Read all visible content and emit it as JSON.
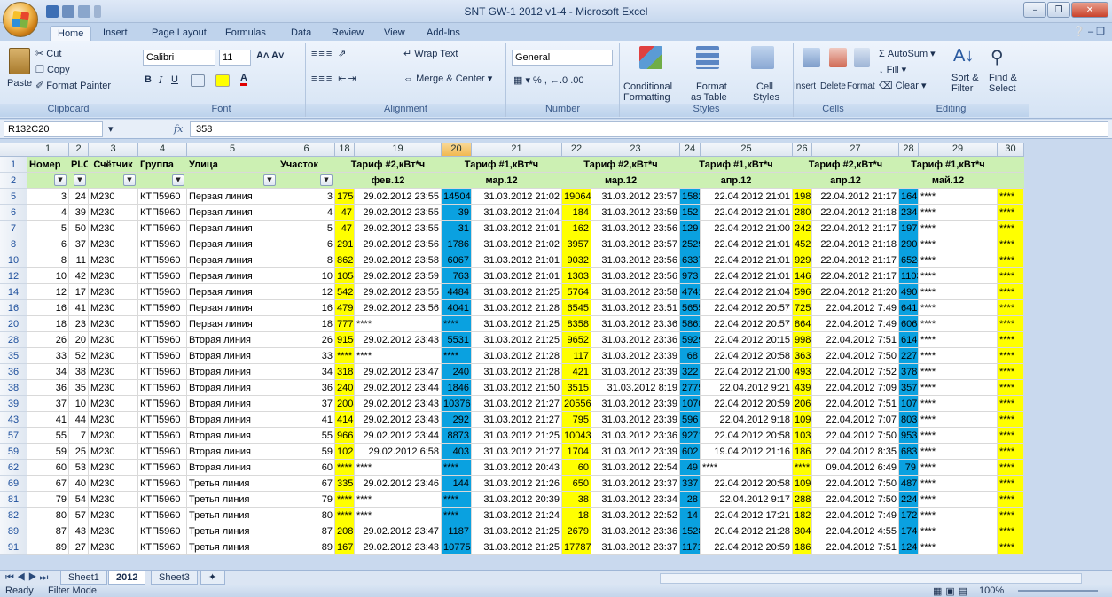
{
  "window": {
    "title": "SNT GW-1 2012 v1-4 - Microsoft Excel"
  },
  "ribbon_tabs": [
    "Home",
    "Insert",
    "Page Layout",
    "Formulas",
    "Data",
    "Review",
    "View",
    "Add-Ins"
  ],
  "ribbon": {
    "clipboard": {
      "label": "Clipboard",
      "paste": "Paste",
      "cut": "Cut",
      "copy": "Copy",
      "format_painter": "Format Painter"
    },
    "font": {
      "label": "Font",
      "name": "Calibri",
      "size": "11"
    },
    "alignment": {
      "label": "Alignment",
      "wrap_text": "Wrap Text",
      "merge_center": "Merge & Center"
    },
    "number": {
      "label": "Number",
      "format": "General"
    },
    "styles": {
      "label": "Styles",
      "conditional": "Conditional",
      "conditional2": "Formatting",
      "format_as": "Format",
      "format_as2": "as Table",
      "cell_styles": "Cell",
      "cell_styles2": "Styles"
    },
    "cells": {
      "label": "Cells",
      "insert": "Insert",
      "delete": "Delete",
      "format": "Format"
    },
    "editing": {
      "label": "Editing",
      "autosum": "AutoSum",
      "fill": "Fill",
      "clear": "Clear",
      "sort": "Sort &",
      "sort2": "Filter",
      "find": "Find &",
      "find2": "Select"
    }
  },
  "formula_bar": {
    "name_box": "R132C20",
    "fx": "fx",
    "value": "358"
  },
  "column_headers": [
    "1",
    "2",
    "3",
    "4",
    "5",
    "6",
    "18",
    "19",
    "20",
    "21",
    "22",
    "23",
    "24",
    "25",
    "26",
    "27",
    "28",
    "29",
    "30"
  ],
  "header_row1": [
    "Номер",
    "PLC",
    "Счётчик",
    "Группа",
    "Улица",
    "Участок",
    "Тариф #2,кВт*ч",
    "Тариф #1,кВт*ч",
    "Тариф #2,кВт*ч",
    "Тариф #1,кВт*ч",
    "Тариф #2,кВт*ч",
    "Тариф #1,кВт*ч"
  ],
  "header_row2": [
    "фев.12",
    "мар.12",
    "мар.12",
    "апр.12",
    "апр.12",
    "май.12"
  ],
  "row_numbers": [
    "1",
    "2",
    "5",
    "6",
    "7",
    "8",
    "10",
    "12",
    "14",
    "16",
    "20",
    "28",
    "35",
    "36",
    "38",
    "39",
    "43",
    "57",
    "59",
    "62",
    "69",
    "81",
    "82",
    "89",
    "91"
  ],
  "rows": [
    [
      "3",
      "24",
      "M230",
      "КТП5960",
      "Первая линия",
      "3",
      "17503",
      "29.02.2012 23:55",
      "14504",
      "31.03.2012 21:02",
      "19064",
      "31.03.2012 23:57",
      "15821",
      "22.04.2012 21:01",
      "19831",
      "22.04.2012 21:17",
      "16431",
      "****",
      "****"
    ],
    [
      "4",
      "39",
      "M230",
      "КТП5960",
      "Первая линия",
      "4",
      "47",
      "29.02.2012 23:55",
      "39",
      "31.03.2012 21:04",
      "184",
      "31.03.2012 23:59",
      "152",
      "22.04.2012 21:01",
      "280",
      "22.04.2012 21:18",
      "234",
      "****",
      "****"
    ],
    [
      "5",
      "50",
      "M230",
      "КТП5960",
      "Первая линия",
      "5",
      "47",
      "29.02.2012 23:55",
      "31",
      "31.03.2012 21:01",
      "162",
      "31.03.2012 23:56",
      "129",
      "22.04.2012 21:00",
      "242",
      "22.04.2012 21:17",
      "197",
      "****",
      "****"
    ],
    [
      "6",
      "37",
      "M230",
      "КТП5960",
      "Первая линия",
      "6",
      "2913",
      "29.02.2012 23:56",
      "1786",
      "31.03.2012 21:02",
      "3957",
      "31.03.2012 23:57",
      "2529",
      "22.04.2012 21:01",
      "4528",
      "22.04.2012 21:18",
      "2905",
      "****",
      "****"
    ],
    [
      "8",
      "11",
      "M230",
      "КТП5960",
      "Первая линия",
      "8",
      "8628",
      "29.02.2012 23:58",
      "6067",
      "31.03.2012 21:01",
      "9032",
      "31.03.2012 23:56",
      "6337",
      "22.04.2012 21:01",
      "9291",
      "22.04.2012 21:17",
      "6524",
      "****",
      "****"
    ],
    [
      "10",
      "42",
      "M230",
      "КТП5960",
      "Первая линия",
      "10",
      "1054",
      "29.02.2012 23:59",
      "763",
      "31.03.2012 21:01",
      "1303",
      "31.03.2012 23:56",
      "973",
      "22.04.2012 21:01",
      "1462",
      "22.04.2012 21:17",
      "1103",
      "****",
      "****"
    ],
    [
      "12",
      "17",
      "M230",
      "КТП5960",
      "Первая линия",
      "12",
      "5428",
      "29.02.2012 23:55",
      "4484",
      "31.03.2012 21:25",
      "5764",
      "31.03.2012 23:58",
      "4741",
      "22.04.2012 21:04",
      "5965",
      "22.04.2012 21:20",
      "4903",
      "****",
      "****"
    ],
    [
      "16",
      "41",
      "M230",
      "КТП5960",
      "Первая линия",
      "16",
      "4793",
      "29.02.2012 23:56",
      "4041",
      "31.03.2012 21:28",
      "6545",
      "31.03.2012 23:51",
      "5655",
      "22.04.2012 20:57",
      "7259",
      "22.04.2012 7:49",
      "6413",
      "****",
      "****"
    ],
    [
      "18",
      "23",
      "M230",
      "КТП5960",
      "Первая линия",
      "18",
      "7773",
      "****",
      "****",
      "31.03.2012 21:25",
      "8358",
      "31.03.2012 23:36",
      "5861",
      "22.04.2012 20:57",
      "8645",
      "22.04.2012 7:49",
      "6068",
      "****",
      "****"
    ],
    [
      "26",
      "20",
      "M230",
      "КТП5960",
      "Вторая линия",
      "26",
      "9150",
      "29.02.2012 23:43",
      "5531",
      "31.03.2012 21:25",
      "9652",
      "31.03.2012 23:36",
      "5929",
      "22.04.2012 20:15",
      "9983",
      "22.04.2012 7:51",
      "6147",
      "****",
      "****"
    ],
    [
      "33",
      "52",
      "M230",
      "КТП5960",
      "Вторая линия",
      "33",
      "****",
      "****",
      "****",
      "31.03.2012 21:28",
      "117",
      "31.03.2012 23:39",
      "68",
      "22.04.2012 20:58",
      "363",
      "22.04.2012 7:50",
      "227",
      "****",
      "****"
    ],
    [
      "34",
      "38",
      "M230",
      "КТП5960",
      "Вторая линия",
      "34",
      "318",
      "29.02.2012 23:47",
      "240",
      "31.03.2012 21:28",
      "421",
      "31.03.2012 23:39",
      "322",
      "22.04.2012 21:00",
      "493",
      "22.04.2012 7:52",
      "378",
      "****",
      "****"
    ],
    [
      "36",
      "35",
      "M230",
      "КТП5960",
      "Вторая линия",
      "36",
      "2409",
      "29.02.2012 23:44",
      "1846",
      "31.03.2012 21:50",
      "3515",
      "31.03.2012 8:19",
      "2775",
      "22.04.2012 9:21",
      "4391",
      "22.04.2012 7:09",
      "3571",
      "****",
      "****"
    ],
    [
      "37",
      "10",
      "M230",
      "КТП5960",
      "Вторая линия",
      "37",
      "20086",
      "29.02.2012 23:43",
      "10376",
      "31.03.2012 21:27",
      "20556",
      "31.03.2012 23:39",
      "10704",
      "22.04.2012 20:59",
      "20697",
      "22.04.2012 7:51",
      "10793",
      "****",
      "****"
    ],
    [
      "41",
      "44",
      "M230",
      "КТП5960",
      "Вторая линия",
      "41",
      "414",
      "29.02.2012 23:43",
      "292",
      "31.03.2012 21:27",
      "795",
      "31.03.2012 23:39",
      "596",
      "22.04.2012 9:18",
      "1091",
      "22.04.2012 7:07",
      "803",
      "****",
      "****"
    ],
    [
      "55",
      "7",
      "M230",
      "КТП5960",
      "Вторая линия",
      "55",
      "9662",
      "29.02.2012 23:44",
      "8873",
      "31.03.2012 21:25",
      "10043",
      "31.03.2012 23:36",
      "9271",
      "22.04.2012 20:58",
      "10314",
      "22.04.2012 7:50",
      "9536",
      "****",
      "****"
    ],
    [
      "59",
      "25",
      "M230",
      "КТП5960",
      "Вторая линия",
      "59",
      "1022",
      "29.02.2012 6:58",
      "403",
      "31.03.2012 21:27",
      "1704",
      "31.03.2012 23:39",
      "602",
      "19.04.2012 21:16",
      "1867",
      "22.04.2012 8:35",
      "683",
      "****",
      "****"
    ],
    [
      "60",
      "53",
      "M230",
      "КТП5960",
      "Вторая линия",
      "60",
      "****",
      "****",
      "****",
      "31.03.2012 20:43",
      "60",
      "31.03.2012 22:54",
      "49",
      "****",
      "****",
      "09.04.2012 6:49",
      "79",
      "****",
      "****"
    ],
    [
      "67",
      "40",
      "M230",
      "КТП5960",
      "Третья линия",
      "67",
      "335",
      "29.02.2012 23:46",
      "144",
      "31.03.2012 21:26",
      "650",
      "31.03.2012 23:37",
      "337",
      "22.04.2012 20:58",
      "1099",
      "22.04.2012 7:50",
      "487",
      "****",
      "****"
    ],
    [
      "79",
      "54",
      "M230",
      "КТП5960",
      "Третья линия",
      "79",
      "****",
      "****",
      "****",
      "31.03.2012 20:39",
      "38",
      "31.03.2012 23:34",
      "28",
      "22.04.2012 9:17",
      "288",
      "22.04.2012 7:50",
      "224",
      "****",
      "****"
    ],
    [
      "80",
      "57",
      "M230",
      "КТП5960",
      "Третья линия",
      "80",
      "****",
      "****",
      "****",
      "31.03.2012 21:24",
      "18",
      "31.03.2012 22:52",
      "14",
      "22.04.2012 17:21",
      "182",
      "22.04.2012 7:49",
      "172",
      "****",
      "****"
    ],
    [
      "87",
      "43",
      "M230",
      "КТП5960",
      "Третья линия",
      "87",
      "2089",
      "29.02.2012 23:47",
      "1187",
      "31.03.2012 21:25",
      "2679",
      "31.03.2012 23:36",
      "1528",
      "20.04.2012 21:28",
      "3042",
      "22.04.2012 4:55",
      "1745",
      "****",
      "****"
    ],
    [
      "89",
      "27",
      "M230",
      "КТП5960",
      "Третья линия",
      "89",
      "16716",
      "29.02.2012 23:43",
      "10775",
      "31.03.2012 21:25",
      "17787",
      "31.03.2012 23:37",
      "11715",
      "22.04.2012 20:59",
      "18635",
      "22.04.2012 7:51",
      "12422",
      "****",
      "****"
    ]
  ],
  "sheet_tabs": [
    "Sheet1",
    "2012",
    "Sheet3"
  ],
  "active_sheet": "2012",
  "status": {
    "ready": "Ready",
    "mode": "Filter Mode",
    "zoom": "100%"
  },
  "colors": {
    "yellow": "#ffff00",
    "blue": "#0aa1e0",
    "header_green": "#ccf0b3"
  }
}
